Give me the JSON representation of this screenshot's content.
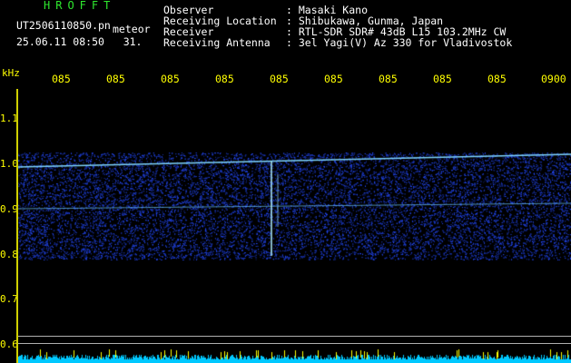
{
  "header": {
    "title": "HROFFT",
    "filename": "UT2506110850.pn",
    "tag": "meteor",
    "datetime": "25.06.11 08:50   31.",
    "labels": "Observer\nReceiving Location\nReceiver\nReceiving Antenna",
    "values": ": Masaki Kano\n: Shibukawa, Gunma, Japan\n: RTL-SDR SDR# 43dB L15 103.2MHz CW\n: 3el Yagi(V) Az 330 for Vladivostok"
  },
  "axis": {
    "ylabel": "kHz",
    "xticks": [
      "085",
      "085",
      "085",
      "085",
      "085",
      "085",
      "085",
      "085",
      "085",
      "0900"
    ],
    "yticks": [
      "1.1",
      "1.0",
      "0.9",
      "0.8",
      "0.7",
      "0.6"
    ]
  },
  "colors": {
    "background": "#000000",
    "title": "#2ee82e",
    "axis": "#ffff00",
    "text": "#ffffff",
    "noise": "#1e3cff",
    "signal": "#6fd8ff",
    "baseline": "#00c8ff"
  }
}
